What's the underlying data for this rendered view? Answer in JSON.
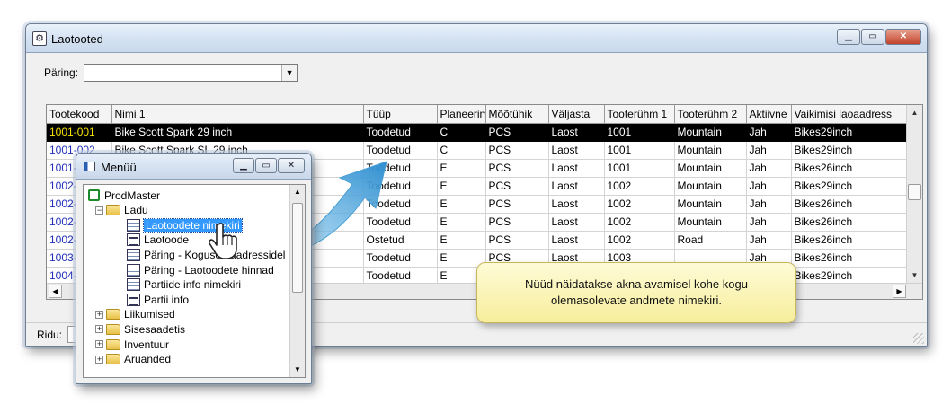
{
  "main_window": {
    "title": "Laotooted",
    "query_label": "Päring:",
    "query_value": "",
    "status": {
      "rows_label": "Ridu:",
      "rows_value": ""
    }
  },
  "grid": {
    "columns": [
      "Tootekood",
      "Nimi 1",
      "Tüüp",
      "Planeerim",
      "Mõõtühik",
      "Väljasta",
      "Tooterühm 1",
      "Tooterühm 2",
      "Aktiivne",
      "Vaikimisi laoaadress"
    ],
    "rows": [
      [
        "1001-001",
        "Bike Scott Spark 29 inch",
        "Toodetud",
        "C",
        "PCS",
        "Laost",
        "1001",
        "Mountain",
        "Jah",
        "Bikes29inch"
      ],
      [
        "1001-002",
        "Bike Scott Spark SL 29 inch",
        "Toodetud",
        "C",
        "PCS",
        "Laost",
        "1001",
        "Mountain",
        "Jah",
        "Bikes29inch"
      ],
      [
        "1001-",
        "",
        "Toodetud",
        "E",
        "PCS",
        "Laost",
        "1001",
        "Mountain",
        "Jah",
        "Bikes26inch"
      ],
      [
        "1002-",
        "",
        "Toodetud",
        "E",
        "PCS",
        "Laost",
        "1002",
        "Mountain",
        "Jah",
        "Bikes29inch"
      ],
      [
        "1002-",
        "",
        "Toodetud",
        "E",
        "PCS",
        "Laost",
        "1002",
        "Mountain",
        "Jah",
        "Bikes26inch"
      ],
      [
        "1002-",
        "",
        "Toodetud",
        "E",
        "PCS",
        "Laost",
        "1002",
        "Mountain",
        "Jah",
        "Bikes26inch"
      ],
      [
        "1002-",
        "",
        "Ostetud",
        "E",
        "PCS",
        "Laost",
        "1002",
        "Road",
        "Jah",
        "Bikes26inch"
      ],
      [
        "1003-",
        "",
        "Toodetud",
        "E",
        "PCS",
        "Laost",
        "1003",
        "",
        "Jah",
        "Bikes26inch"
      ],
      [
        "1004-",
        "",
        "Toodetud",
        "E",
        "",
        "",
        "",
        "",
        "",
        "Bikes29inch"
      ]
    ],
    "selected_row": 0
  },
  "menu_window": {
    "title": "Menüü",
    "tree": [
      {
        "label": "ProdMaster",
        "level": 0,
        "icon": "root-icon",
        "expander": ""
      },
      {
        "label": "Ladu",
        "level": 1,
        "icon": "folder-open-icon",
        "expander": "−"
      },
      {
        "label": "Laotoodete nimekiri",
        "level": 2,
        "icon": "grid-doc-icon",
        "expander": "",
        "selected": true
      },
      {
        "label": "Laotoode",
        "level": 2,
        "icon": "form-doc-icon",
        "expander": ""
      },
      {
        "label": "Päring - Kogused aadressidel",
        "level": 2,
        "icon": "grid-doc-icon",
        "expander": ""
      },
      {
        "label": "Päring - Laotoodete hinnad",
        "level": 2,
        "icon": "grid-doc-icon",
        "expander": ""
      },
      {
        "label": "Partiide info nimekiri",
        "level": 2,
        "icon": "grid-doc-icon",
        "expander": ""
      },
      {
        "label": "Partii info",
        "level": 2,
        "icon": "form-doc-icon",
        "expander": ""
      },
      {
        "label": "Liikumised",
        "level": 1,
        "icon": "folder-icon",
        "expander": "+"
      },
      {
        "label": "Sisesaadetis",
        "level": 1,
        "icon": "folder-icon",
        "expander": "+"
      },
      {
        "label": "Inventuur",
        "level": 1,
        "icon": "folder-icon",
        "expander": "+"
      },
      {
        "label": "Aruanded",
        "level": 1,
        "icon": "folder-icon",
        "expander": "+"
      }
    ]
  },
  "callout": {
    "text": "Nüüd näidatakse akna avamisel kohe kogu olemasolevate andmete nimekiri."
  },
  "colors": {
    "selection": "#000000",
    "selected_code": "#f4e100",
    "code_link": "#2230b8",
    "tree_highlight": "#3399ff",
    "arrow": "#3aa3dd",
    "callout_bg": "#fbf4b4"
  }
}
